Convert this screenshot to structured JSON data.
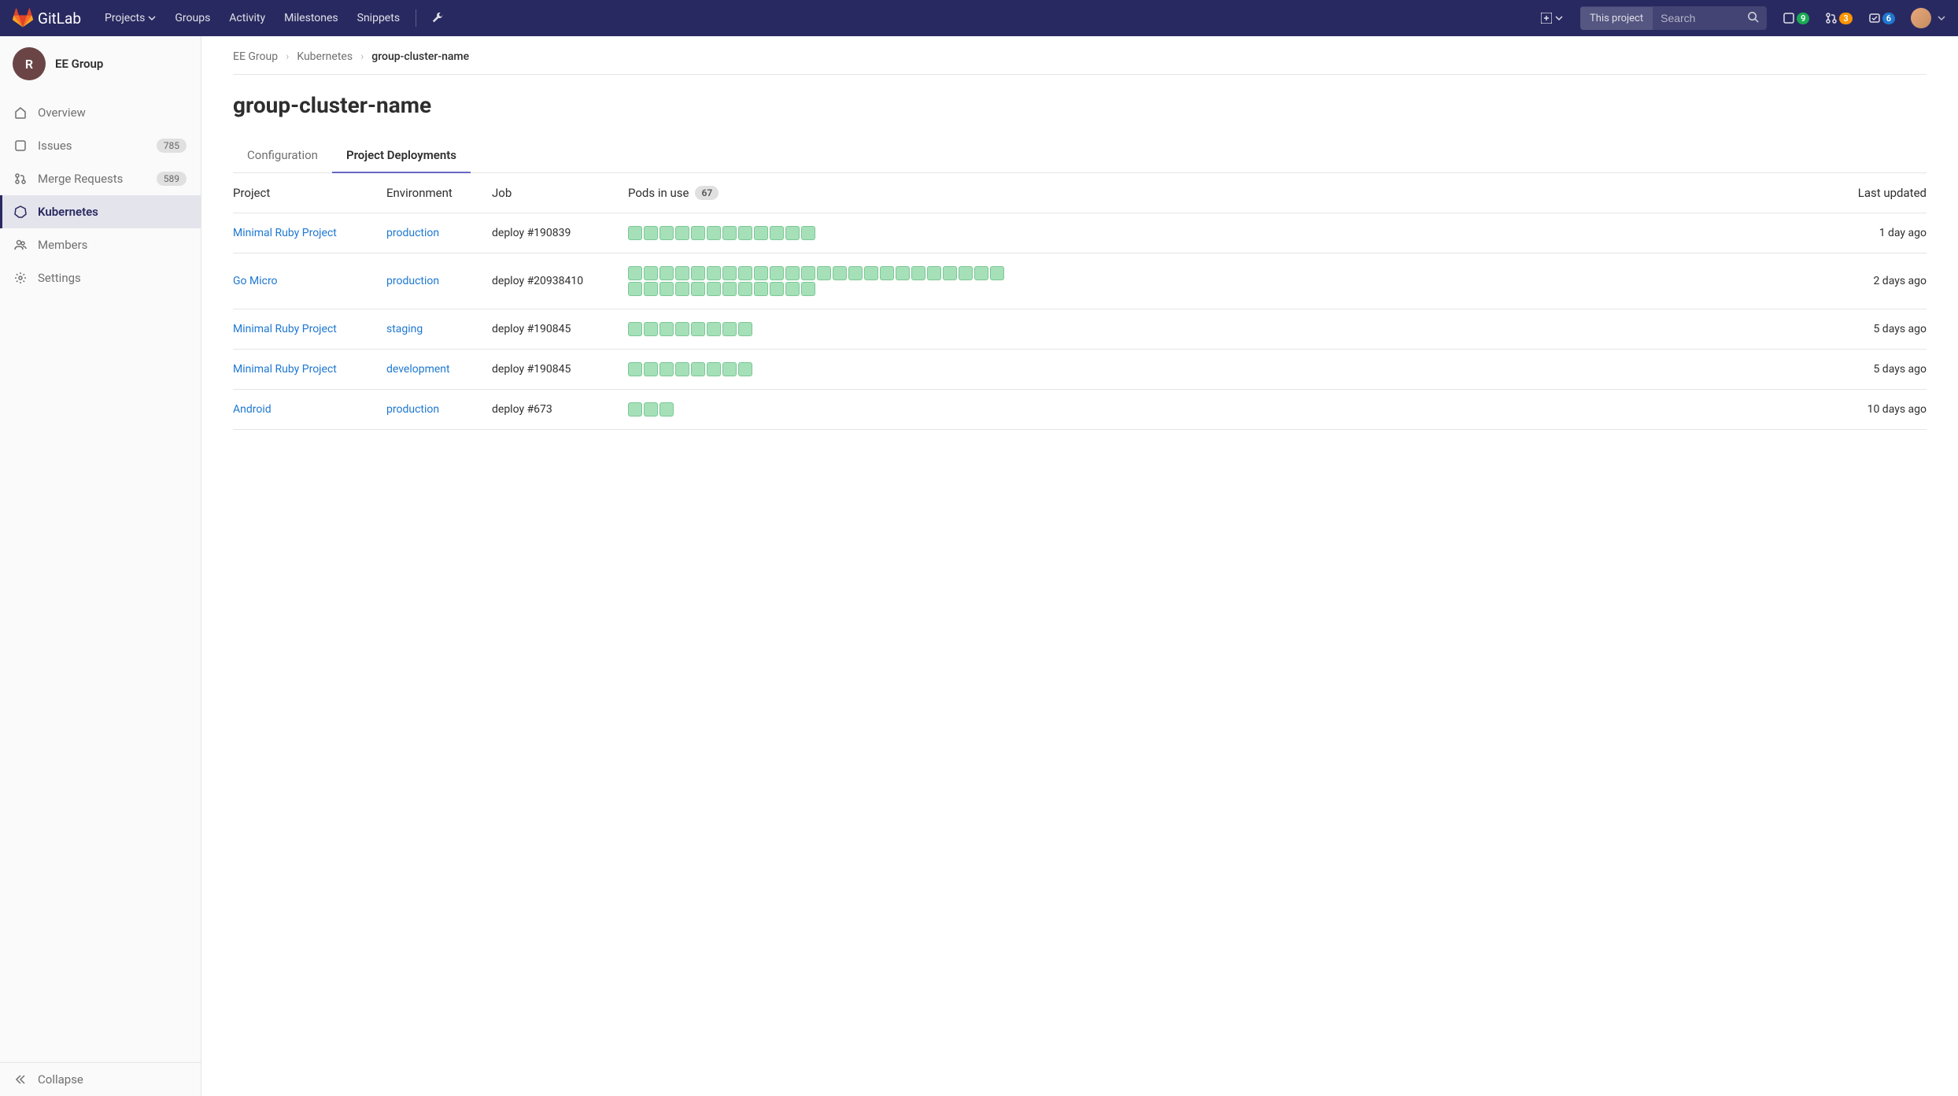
{
  "brand": "GitLab",
  "topnav": {
    "items": [
      "Projects",
      "Groups",
      "Activity",
      "Milestones",
      "Snippets"
    ],
    "search_scope": "This project",
    "search_placeholder": "Search",
    "counters": {
      "issues": "9",
      "mrs": "3",
      "todos": "6"
    }
  },
  "sidebar": {
    "group_initial": "R",
    "group_name": "EE Group",
    "items": [
      {
        "label": "Overview",
        "badge": ""
      },
      {
        "label": "Issues",
        "badge": "785"
      },
      {
        "label": "Merge Requests",
        "badge": "589"
      },
      {
        "label": "Kubernetes",
        "badge": ""
      },
      {
        "label": "Members",
        "badge": ""
      },
      {
        "label": "Settings",
        "badge": ""
      }
    ],
    "collapse": "Collapse"
  },
  "breadcrumb": {
    "a": "EE Group",
    "b": "Kubernetes",
    "c": "group-cluster-name"
  },
  "page_title": "group-cluster-name",
  "tabs": {
    "config": "Configuration",
    "deployments": "Project Deployments"
  },
  "table": {
    "headers": {
      "project": "Project",
      "env": "Environment",
      "job": "Job",
      "pods": "Pods in use",
      "pods_total": "67",
      "updated": "Last updated"
    },
    "rows": [
      {
        "project": "Minimal Ruby Project",
        "env": "production",
        "job": "deploy #190839",
        "pods": 12,
        "updated": "1 day ago"
      },
      {
        "project": "Go Micro",
        "env": "production",
        "job": "deploy #20938410",
        "pods": 36,
        "updated": "2 days ago"
      },
      {
        "project": "Minimal Ruby Project",
        "env": "staging",
        "job": "deploy #190845",
        "pods": 8,
        "updated": "5 days ago"
      },
      {
        "project": "Minimal Ruby Project",
        "env": "development",
        "job": "deploy #190845",
        "pods": 8,
        "updated": "5 days ago"
      },
      {
        "project": "Android",
        "env": "production",
        "job": "deploy #673",
        "pods": 3,
        "updated": "10 days ago"
      }
    ]
  }
}
